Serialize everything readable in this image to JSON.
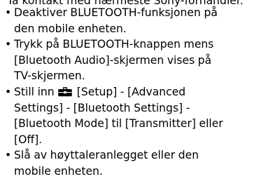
{
  "doc": {
    "cut_line": "Ta kontakt med nærmeste Sony-forhandler.",
    "bullet_char": "•",
    "items": [
      {
        "lines": [
          "Deaktiver BLUETOOTH-funksjonen på",
          "den mobile enheten."
        ]
      },
      {
        "lines": [
          "Trykk på BLUETOOTH-knappen mens",
          "[Bluetooth Audio]-skjermen vises på",
          "TV-skjermen."
        ]
      },
      {
        "line1_after_icon": "[Setup] - [Advanced",
        "line1_before_icon": "Still inn",
        "icon": "toolbox-icon",
        "lines_rest": [
          "Settings] - [Bluetooth Settings] -",
          "[Bluetooth Mode] til [Transmitter] eller",
          "[Off]."
        ]
      },
      {
        "lines": [
          "Slå av høyttaleranlegget eller den",
          "mobile enheten."
        ]
      }
    ]
  }
}
